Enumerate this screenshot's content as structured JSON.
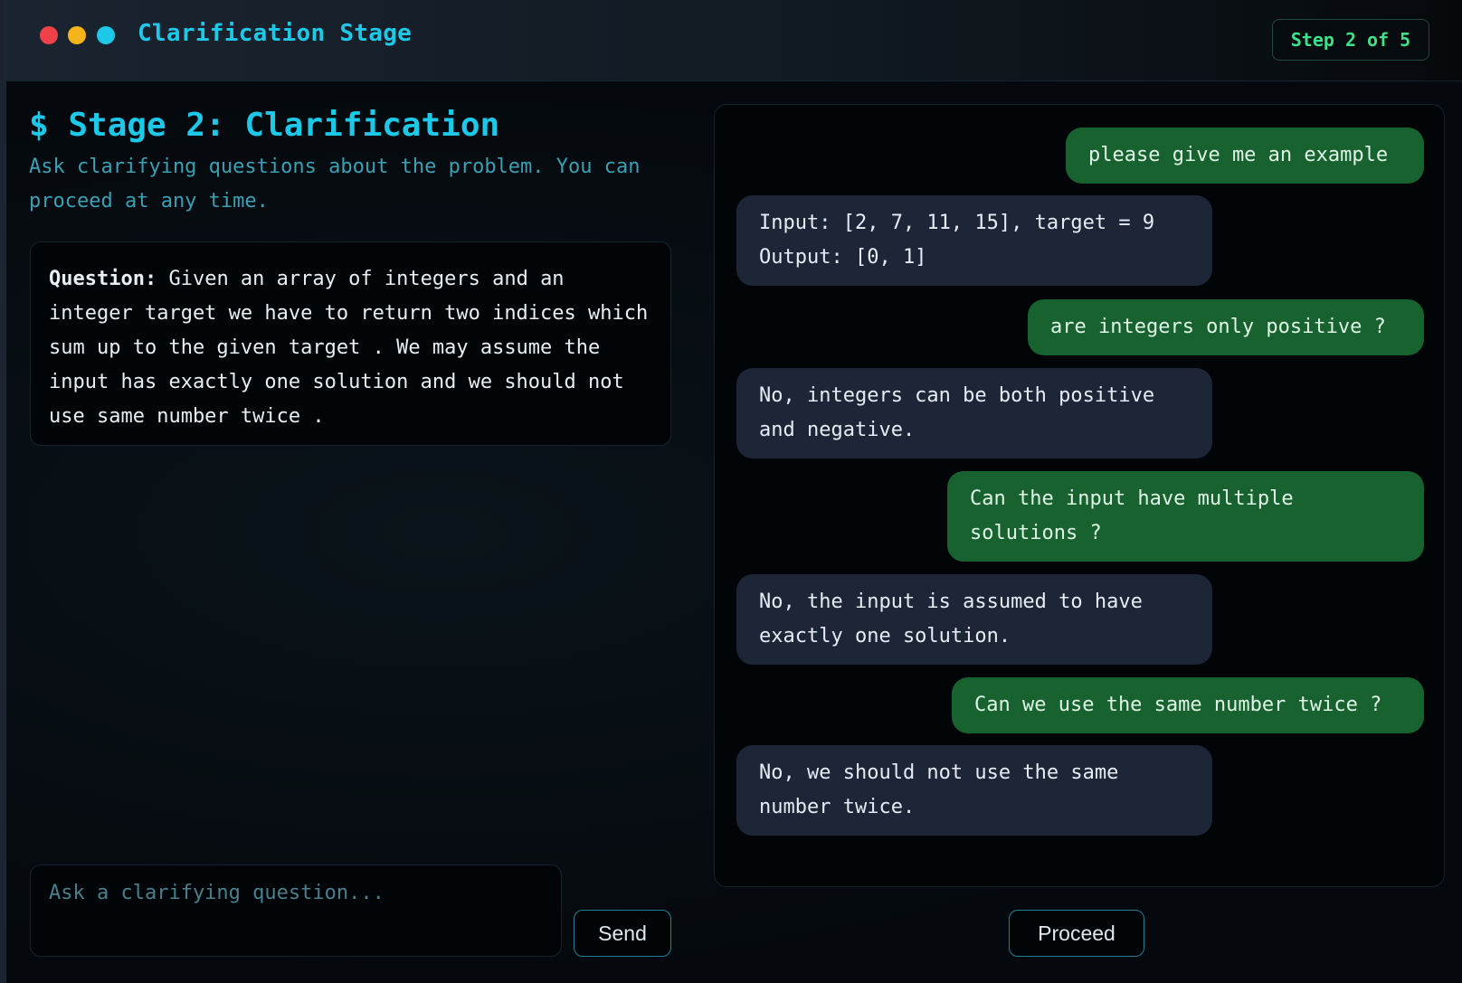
{
  "window": {
    "title": "Clarification Stage",
    "step_badge": "Step 2 of 5",
    "traffic_lights": {
      "red": "#f0414a",
      "yellow": "#f5b41a",
      "cyan": "#1ec8e8"
    }
  },
  "stage": {
    "title": "$ Stage 2: Clarification",
    "subtitle": "Ask clarifying questions about the problem. You can proceed at any time."
  },
  "question": {
    "label": "Question:",
    "text": " Given an array of integers and an integer target we have to return two indices which sum up to the given target . We may assume the input has exactly one solution and we should not use same number twice ."
  },
  "input": {
    "placeholder": "Ask a clarifying question...",
    "value": ""
  },
  "buttons": {
    "send": "Send",
    "proceed": "Proceed"
  },
  "chat": {
    "messages": [
      {
        "role": "user",
        "text": "please give me an example"
      },
      {
        "role": "assistant",
        "text": "Input: [2, 7, 11, 15], target = 9\nOutput: [0, 1]"
      },
      {
        "role": "user",
        "text": "are integers only positive ?"
      },
      {
        "role": "assistant",
        "text": "No, integers can be both positive and negative."
      },
      {
        "role": "user",
        "text": "Can the input have multiple solutions ?"
      },
      {
        "role": "assistant",
        "text": "No, the input is assumed to have exactly one solution."
      },
      {
        "role": "user",
        "text": "Can we use the same number twice ?"
      },
      {
        "role": "assistant",
        "text": "No, we should not use the same number twice."
      }
    ]
  },
  "colors": {
    "accent": "#1ec8e8",
    "badge_green": "#3ee08a",
    "user_bubble": "#17622f",
    "bot_bubble": "#1d2637"
  }
}
